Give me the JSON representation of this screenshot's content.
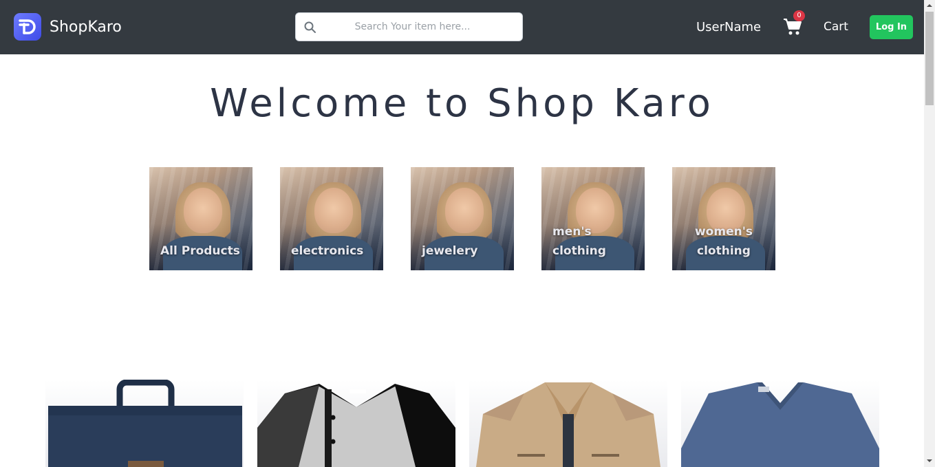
{
  "navbar": {
    "brand_name": "ShopKaro",
    "search_placeholder": "Search Your item here...",
    "username": "UserName",
    "cart_count": "0",
    "cart_label": "Cart",
    "login_label": "Log In"
  },
  "hero": {
    "title": "Welcome to Shop Karo"
  },
  "categories": [
    {
      "label": "All Products"
    },
    {
      "label": "electronics"
    },
    {
      "label": "jewelery"
    },
    {
      "label": "men's clothing"
    },
    {
      "label": "women's clothing"
    }
  ],
  "products": [
    {
      "icon": "backpack-image"
    },
    {
      "icon": "raglan-shirt-image"
    },
    {
      "icon": "jacket-image"
    },
    {
      "icon": "vneck-tshirt-image"
    }
  ],
  "colors": {
    "navbar": "#343a40",
    "login_button": "#22c55e",
    "badge": "#dc3545",
    "title": "#2d3445"
  }
}
